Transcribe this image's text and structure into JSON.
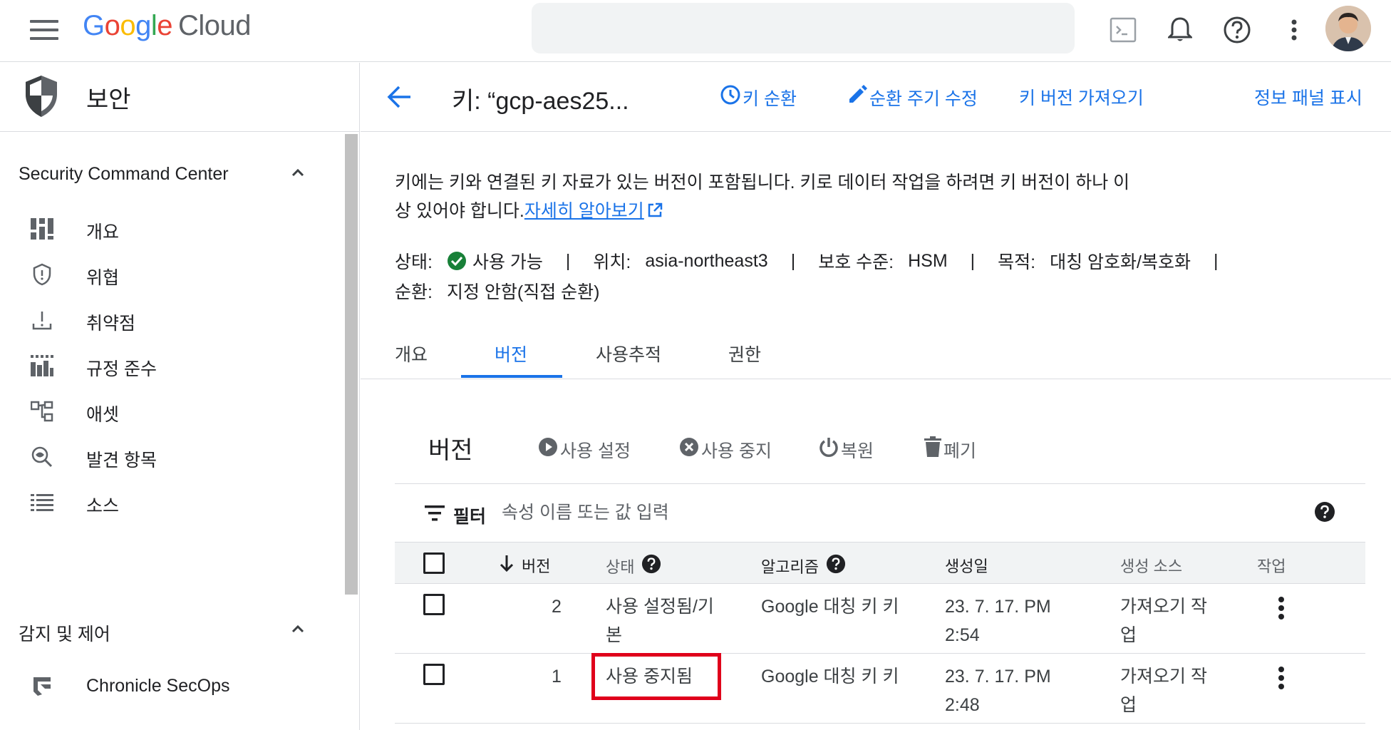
{
  "topbar": {
    "logo_google": [
      "G",
      "o",
      "o",
      "g",
      "l",
      "e"
    ],
    "logo_cloud": "Cloud",
    "search_value": ""
  },
  "leftnav": {
    "title": "보안",
    "sections": [
      {
        "title": "Security Command Center",
        "items": [
          {
            "label": "개요",
            "icon": "dashboard-icon"
          },
          {
            "label": "위협",
            "icon": "shield-alert-icon"
          },
          {
            "label": "취약점",
            "icon": "vulnerability-icon"
          },
          {
            "label": "규정 준수",
            "icon": "compliance-icon"
          },
          {
            "label": "애셋",
            "icon": "assets-icon"
          },
          {
            "label": "발견 항목",
            "icon": "findings-icon"
          },
          {
            "label": "소스",
            "icon": "sources-icon"
          }
        ]
      },
      {
        "title": "감지 및 제어",
        "items": [
          {
            "label": "Chronicle SecOps",
            "icon": "chronicle-icon"
          }
        ]
      }
    ]
  },
  "header": {
    "title": "키: “gcp-aes25...",
    "rotate_key": "키 순환",
    "edit_rotation": "순환 주기 수정",
    "import_version": "키 버전 가져오기",
    "show_info_panel": "정보 패널 표시"
  },
  "description": {
    "text": "키에는 키와 연결된 키 자료가 있는 버전이 포함됩니다. 키로 데이터 작업을 하려면 키 버전이 하나 이상 있어야 합니다.",
    "link": "자세히 알아보기"
  },
  "status": {
    "state_label": "상태:",
    "state_value": "사용 가능",
    "location_label": "위치:",
    "location_value": "asia-northeast3",
    "protection_label": "보호 수준:",
    "protection_value": "HSM",
    "purpose_label": "목적:",
    "purpose_value": "대칭 암호화/복호화",
    "separator": "|",
    "rotation_label": "순환:",
    "rotation_value": "지정 안함(직접 순환)"
  },
  "tabs": [
    "개요",
    "버전",
    "사용추적",
    "권한"
  ],
  "active_tab": "버전",
  "versions": {
    "title": "버전",
    "actions": {
      "enable": "사용 설정",
      "disable": "사용 중지",
      "restore": "복원",
      "destroy": "폐기"
    },
    "filter_label": "필터",
    "filter_placeholder": "속성 이름 또는 값 입력",
    "columns": {
      "version": "버전",
      "state": "상태",
      "algorithm": "알고리즘",
      "created": "생성일",
      "source": "생성 소스",
      "actions": "작업"
    },
    "rows": [
      {
        "version": "2",
        "state_line1": "사용 설정됨/기",
        "state_line2": "본",
        "algorithm": "Google 대칭 키 키",
        "created_line1": "23. 7. 17. PM",
        "created_line2": "2:54",
        "source_line1": "가져오기 작",
        "source_line2": "업"
      },
      {
        "version": "1",
        "state_line1": "사용 중지됨",
        "state_line2": "",
        "algorithm": "Google 대칭 키 키",
        "created_line1": "23. 7. 17. PM",
        "created_line2": "2:48",
        "source_line1": "가져오기 작",
        "source_line2": "업"
      }
    ]
  },
  "colors": {
    "accent": "#1a73e8",
    "success": "#188038",
    "highlight": "#e0001b"
  }
}
